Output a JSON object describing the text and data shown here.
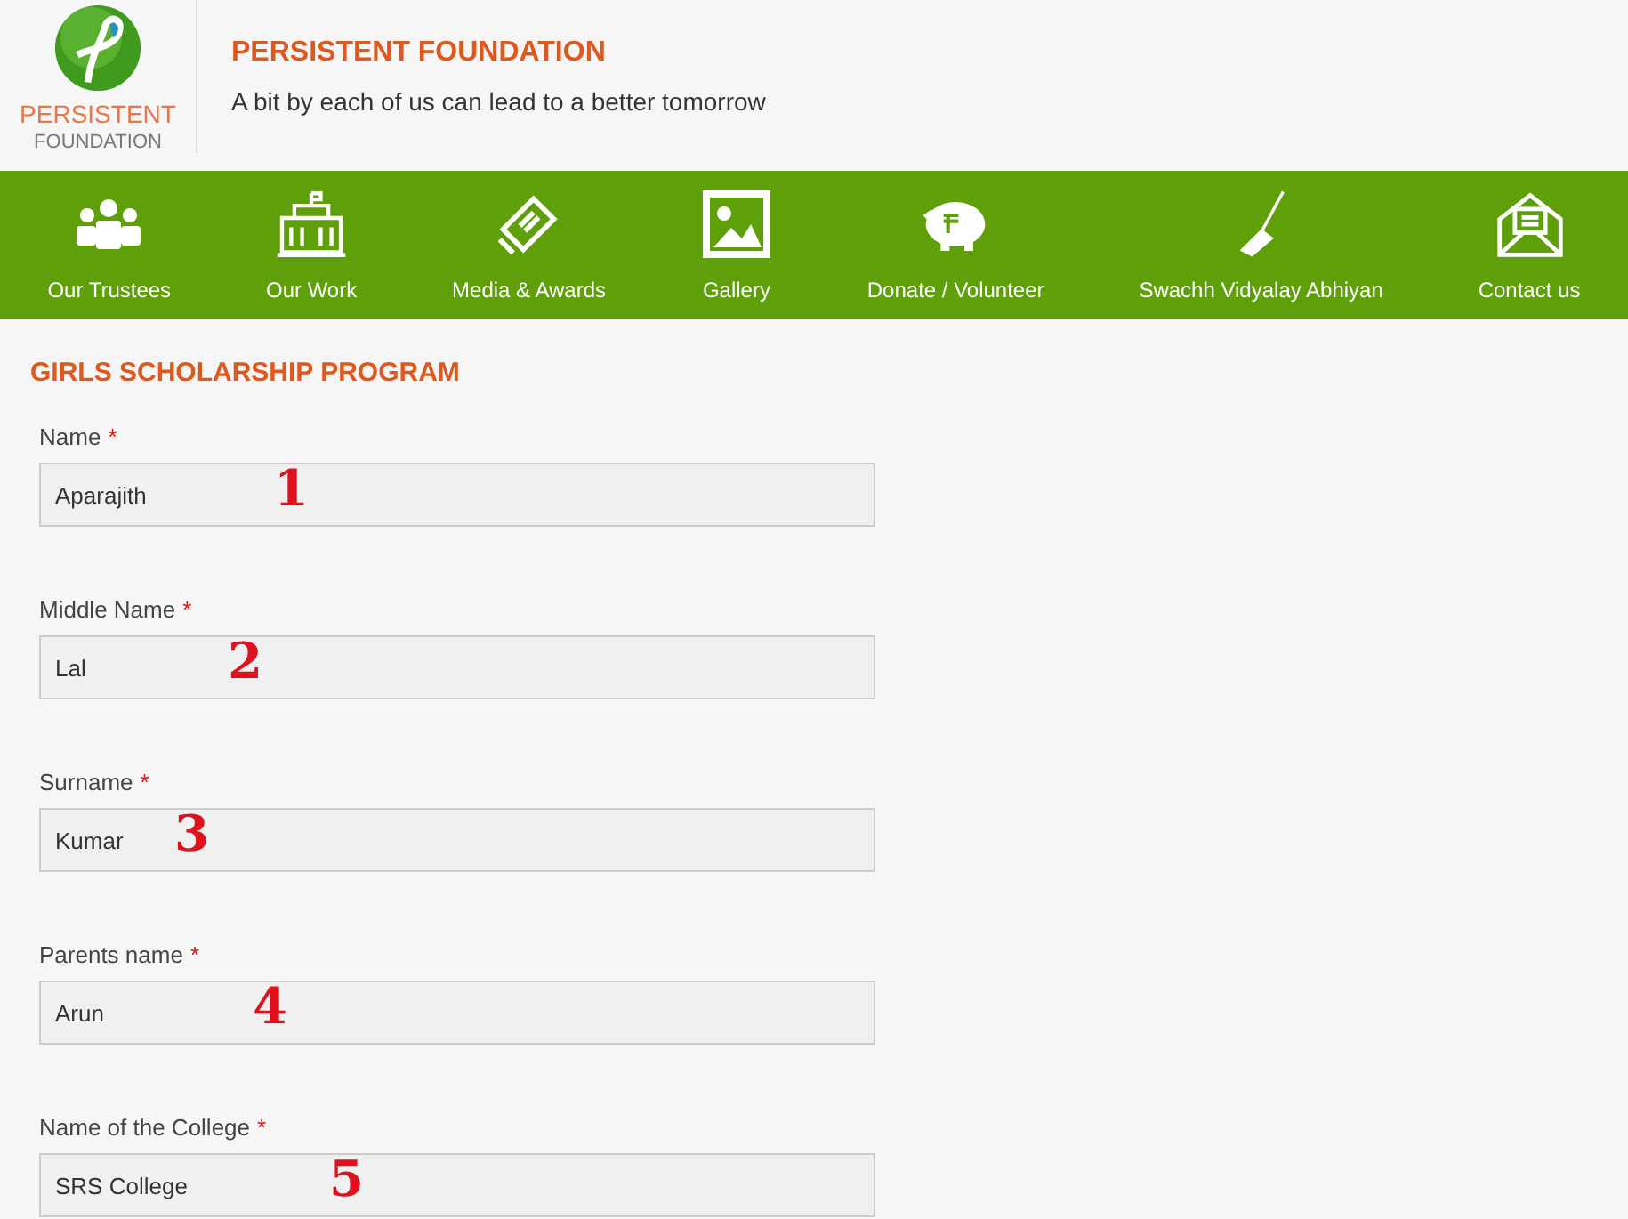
{
  "logo": {
    "line1": "PERSISTENT",
    "line2": "FOUNDATION"
  },
  "header": {
    "title": "PERSISTENT FOUNDATION",
    "tagline": "A bit by each of us can lead to a better tomorrow"
  },
  "nav": [
    {
      "label": "Our Trustees",
      "kind": "people"
    },
    {
      "label": "Our Work",
      "kind": "building"
    },
    {
      "label": "Media & Awards",
      "kind": "card"
    },
    {
      "label": "Gallery",
      "kind": "image"
    },
    {
      "label": "Donate / Volunteer",
      "kind": "piggy"
    },
    {
      "label": "Swachh Vidyalay Abhiyan",
      "kind": "broom"
    },
    {
      "label": "Contact us",
      "kind": "mail"
    }
  ],
  "form": {
    "title": "GIRLS SCHOLARSHIP PROGRAM",
    "fields": [
      {
        "label": "Name",
        "required_mark": "*",
        "value": "Aparajith",
        "marker": "1"
      },
      {
        "label": "Middle Name",
        "required_mark": "*",
        "value": "Lal",
        "marker": "2"
      },
      {
        "label": "Surname",
        "required_mark": "*",
        "value": "Kumar",
        "marker": "3"
      },
      {
        "label": "Parents name",
        "required_mark": "*",
        "value": "Arun",
        "marker": "4"
      },
      {
        "label": "Name of the College",
        "required_mark": "*",
        "value": "SRS College",
        "marker": "5"
      }
    ]
  }
}
